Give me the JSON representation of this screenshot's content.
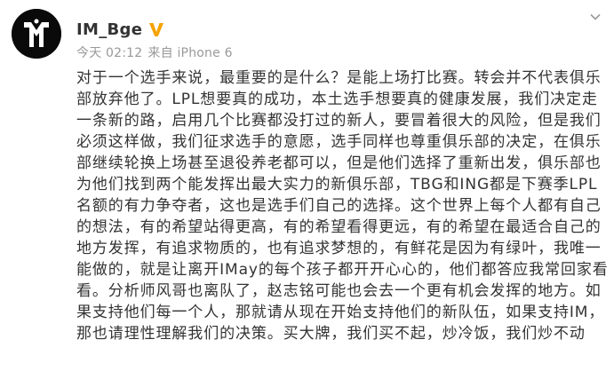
{
  "post": {
    "author": {
      "username": "IM_Bge",
      "avatar_icon": "im-team-logo-icon",
      "verified_icon": "gold-v-verified-icon",
      "verified_color": "#f5a300"
    },
    "meta": {
      "time": "今天 02:12",
      "source": "来自 iPhone 6"
    },
    "menu_icon": "chevron-down-icon",
    "content_lines": [
      "对于一个选手来说，最重要的是什么？是能上场打比赛。转会并不代表俱乐",
      "部放弃他了。LPL想要真的成功，本土选手想要真的健康发展，我们决定走",
      "一条新的路，启用几个比赛都没打过的新人，要冒着很大的风险，但是我们",
      "必须这样做，我们征求选手的意愿，选手同样也尊重俱乐部的决定，在俱乐",
      "部继续轮换上场甚至退役养老都可以，但是他们选择了重新出发，俱乐部也",
      "为他们找到两个能发挥出最大实力的新俱乐部，TBG和ING都是下赛季LPL",
      "名额的有力争夺者，这也是选手们自己的选择。这个世界上每个人都有自己",
      "的想法，有的希望站得更高，有的希望看得更远，有的希望在最适合自己的",
      "地方发挥，有追求物质的，也有追求梦想的，有鲜花是因为有绿叶，我唯一",
      "能做的，就是让离开IMay的每个孩子都开开心心的，他们都答应我常回家看",
      "看。分析师风哥也离队了，赵志铭可能也会去一个更有机会发挥的地方。如",
      "果支持他们每一个人，那就请从现在开始支持他们的新队伍，如果支持IM，",
      "那也请理性理解我们的决策。买大牌，我们买不起，炒冷饭，我们炒不动"
    ]
  }
}
